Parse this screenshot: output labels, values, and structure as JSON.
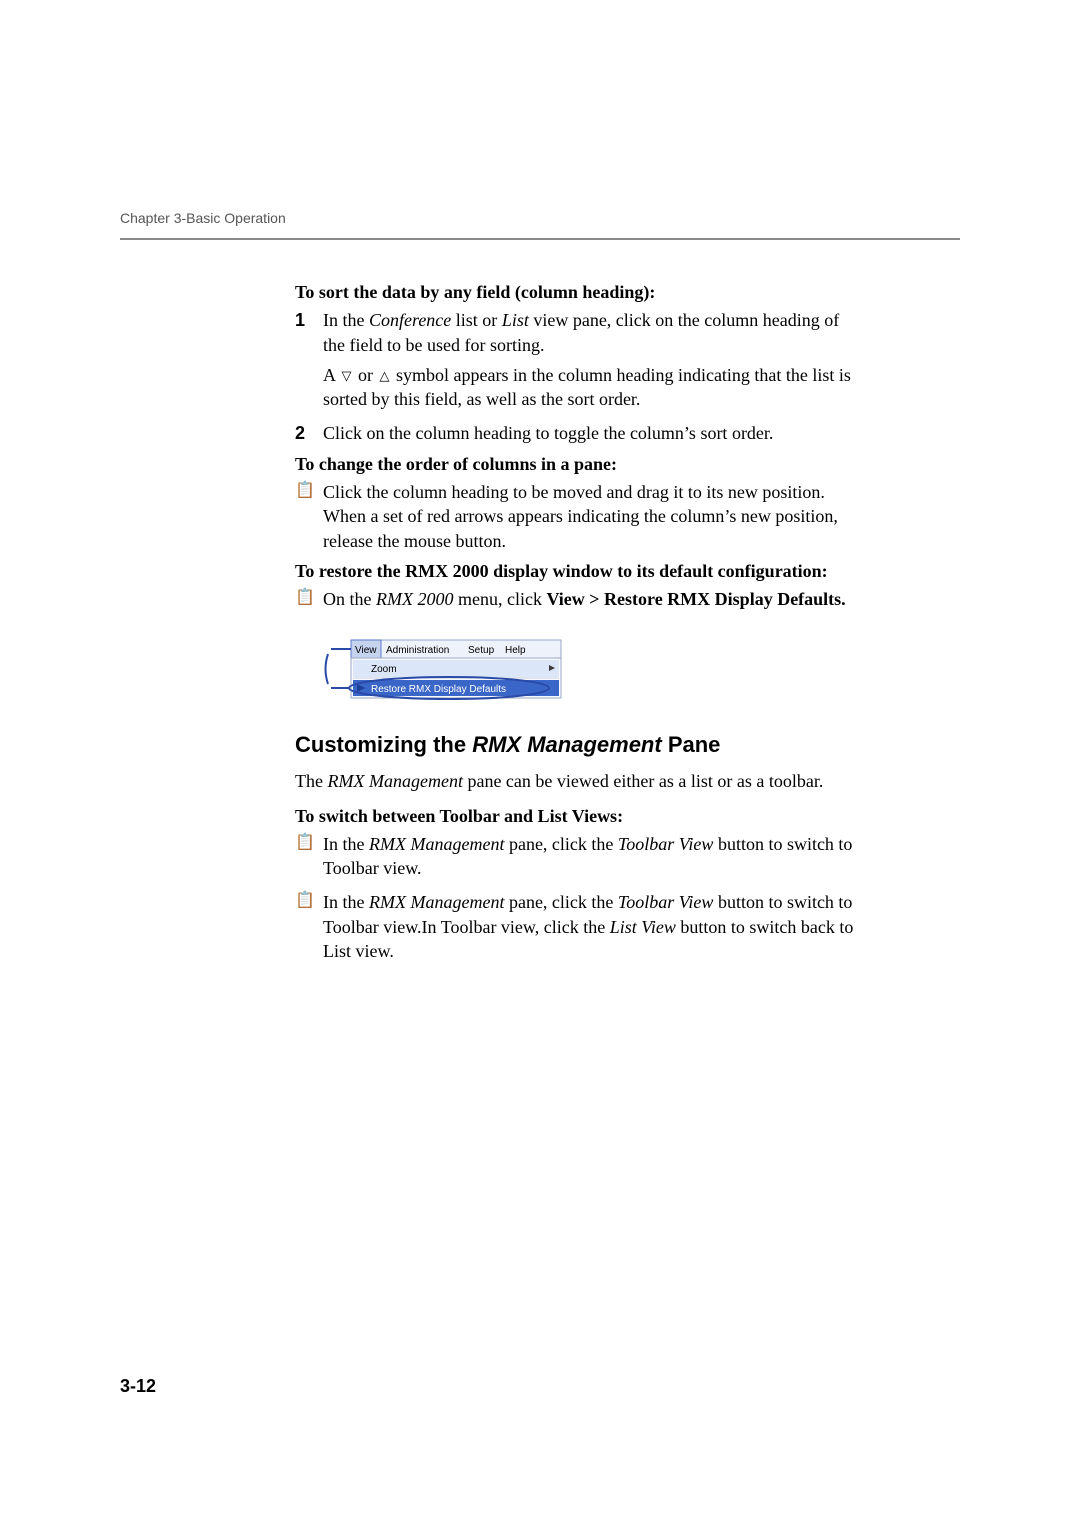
{
  "header": {
    "running_head": "Chapter 3-Basic Operation"
  },
  "page_number": "3-12",
  "proc1": {
    "title": "To sort the data by any field (column heading):",
    "step1_num": "1",
    "step1_a": "In the ",
    "step1_b": "Conference",
    "step1_c": " list or ",
    "step1_d": "List",
    "step1_e": " view pane, click on the column heading of the field to be used for sorting.",
    "step1_note_a": "A ",
    "step1_note_b": " or ",
    "step1_note_c": " symbol appears in the column heading indicating that the list is sorted by this field, as well as the sort order.",
    "step2_num": "2",
    "step2": "Click on the column heading to toggle the column’s sort order."
  },
  "proc2": {
    "title": "To change the order of columns in a pane:",
    "step1": "Click the column heading to be moved and drag it to its new position. When a set of red arrows appears indicating the column’s new position, release the mouse button."
  },
  "proc3": {
    "title": "To restore the RMX 2000 display window to its default configuration:",
    "step1_a": "On the ",
    "step1_b": "RMX 2000",
    "step1_c": " menu, click ",
    "step1_d": "View > Restore RMX Display Defaults."
  },
  "menu": {
    "items": [
      "View",
      "Administration",
      "Setup",
      "Help"
    ],
    "sub1": "Zoom",
    "sub2": "Restore RMX Display Defaults"
  },
  "section": {
    "title_a": "Customizing the ",
    "title_b": "RMX Management",
    "title_c": " Pane",
    "intro_a": "The ",
    "intro_b": "RMX Management",
    "intro_c": " pane can be viewed either as a list or as a toolbar."
  },
  "proc4": {
    "title": "To switch between Toolbar and List Views:",
    "bullet1_a": "In the ",
    "bullet1_b": "RMX Management",
    "bullet1_c": " pane, click the ",
    "bullet1_d": "Toolbar View",
    "bullet1_e": " button to switch to Toolbar view.",
    "bullet2_a": "In the ",
    "bullet2_b": "RMX Management",
    "bullet2_c": " pane, click the ",
    "bullet2_d": "Toolbar View",
    "bullet2_e": " button to switch to Toolbar view.In Toolbar view, click the ",
    "bullet2_f": "List View",
    "bullet2_g": " button to switch back to List view."
  }
}
